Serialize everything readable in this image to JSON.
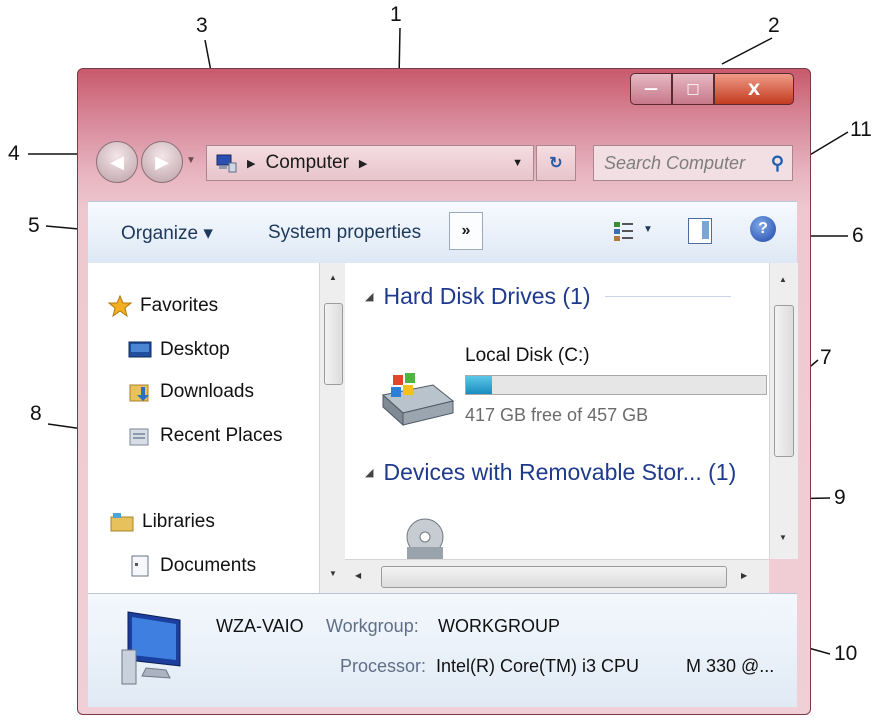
{
  "callouts": [
    "1",
    "2",
    "3",
    "4",
    "5",
    "6",
    "7",
    "8",
    "9",
    "10",
    "11"
  ],
  "titlebar": {
    "minimize": "—",
    "maximize": "□",
    "close": "X"
  },
  "address": {
    "crumb": "Computer"
  },
  "search": {
    "placeholder": "Search Computer"
  },
  "toolbar": {
    "organize": "Organize ▾",
    "system_properties": "System properties",
    "more": "»",
    "help": "?"
  },
  "navpane": {
    "items": [
      {
        "label": "Favorites",
        "icon": "star-icon"
      },
      {
        "label": "Desktop",
        "icon": "desktop-icon"
      },
      {
        "label": "Downloads",
        "icon": "downloads-icon"
      },
      {
        "label": "Recent Places",
        "icon": "recent-places-icon"
      },
      {
        "label": "Libraries",
        "icon": "libraries-icon"
      },
      {
        "label": "Documents",
        "icon": "documents-icon"
      }
    ]
  },
  "content": {
    "groups": [
      {
        "title": "Hard Disk Drives (1)"
      },
      {
        "title": "Devices with Removable Stor... (1)"
      }
    ],
    "drive": {
      "name": "Local Disk (C:)",
      "free_text": "417 GB free of 457 GB",
      "used_fraction": 0.088
    }
  },
  "details": {
    "name": "WZA-VAIO",
    "workgroup_label": "Workgroup:",
    "workgroup_value": "WORKGROUP",
    "processor_label": "Processor:",
    "processor_value": "Intel(R) Core(TM) i3 CPU",
    "processor_tail": "M 330  @..."
  },
  "colors": {
    "frame": "#d8899a",
    "toolbar": "#dde8f5",
    "group_heading": "#1e3a8c",
    "drive_bar": "#1a8cc0",
    "close_button": "#c23b20"
  }
}
